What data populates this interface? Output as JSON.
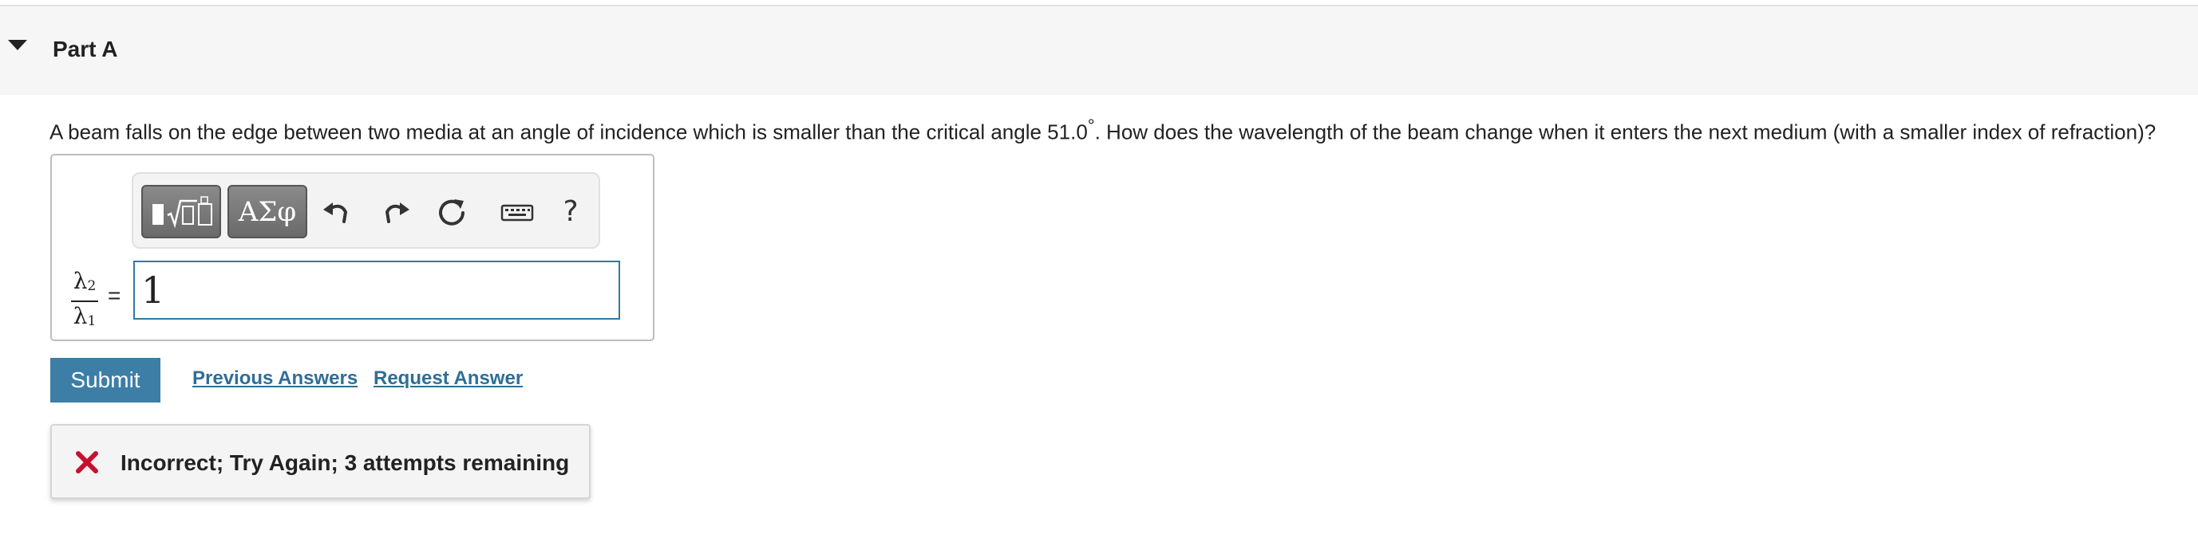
{
  "part": {
    "title": "Part A"
  },
  "question": {
    "text_before": "A beam falls on the edge between two media at an angle of incidence which is smaller than the critical angle 51.0",
    "degree": "°",
    "text_after": ". How does the wavelength of the beam change when it enters the next medium (with a smaller index of refraction)?"
  },
  "toolbar": {
    "templates_label": "templates-icon",
    "symbols_label": "ΑΣφ",
    "undo_icon": "undo-icon",
    "redo_icon": "redo-icon",
    "reset_icon": "reset-icon",
    "keyboard_icon": "keyboard-icon",
    "help_label": "?"
  },
  "answer": {
    "fraction_numerator": "λ",
    "numerator_sub": "2",
    "fraction_denominator": "λ",
    "denominator_sub": "1",
    "equals": "=",
    "value": "1"
  },
  "actions": {
    "submit_label": "Submit",
    "previous_answers_label": "Previous Answers",
    "request_answer_label": "Request Answer"
  },
  "feedback": {
    "icon": "x-icon",
    "message": "Incorrect; Try Again; 3 attempts remaining",
    "icon_color": "#c8102e"
  },
  "colors": {
    "accent": "#3c7ea6",
    "link": "#2e6e99",
    "input_border": "#2e7aa3"
  }
}
